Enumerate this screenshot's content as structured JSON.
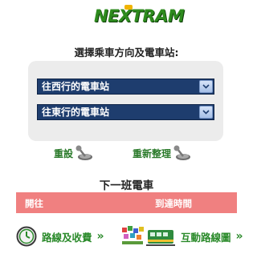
{
  "logo": {
    "text": "NEXTRAM"
  },
  "heading": "選擇乘車方向及電車站:",
  "selects": [
    {
      "value": "往西行的電車站"
    },
    {
      "value": "往東行的電車站"
    }
  ],
  "actions": {
    "reset_label": "重設",
    "reorganize_label": "重新整理"
  },
  "next_tram": {
    "title": "下一班電車",
    "columns": [
      "開往",
      "到達時間"
    ]
  },
  "footer": {
    "route_label": "路線及收費",
    "map_label": "互動路線圖",
    "chevron": "»"
  },
  "colors": {
    "brand_green": "#2e8b1e",
    "select_bg": "#1e3d6e",
    "table_header": "#f08080",
    "link_green": "#2a8a2a"
  }
}
